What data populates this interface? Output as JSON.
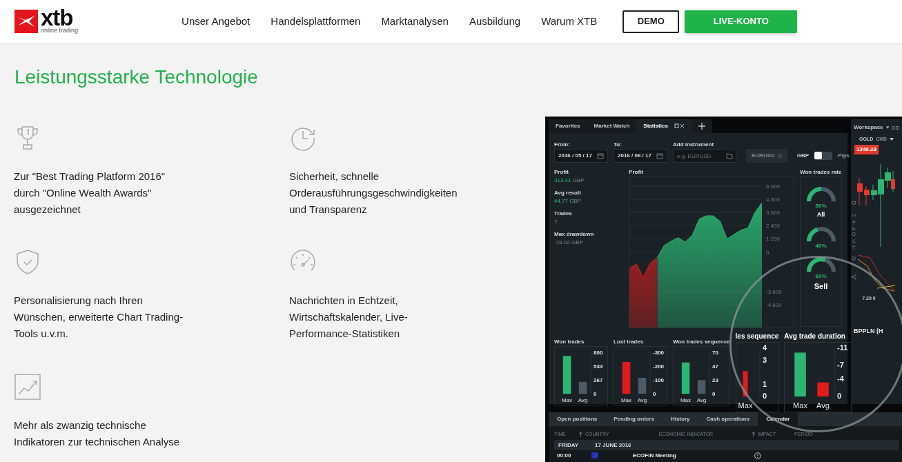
{
  "header": {
    "logo": {
      "wordmark": "xtb",
      "tagline": "online trading"
    },
    "nav": [
      "Unser Angebot",
      "Handelsplattformen",
      "Marktanalysen",
      "Ausbildung",
      "Warum XTB"
    ],
    "buttons": [
      {
        "label": "DEMO",
        "kind": "outline"
      },
      {
        "label": "LIVE-KONTO",
        "kind": "solid"
      }
    ]
  },
  "headline": "Leistungsstarke Technologie",
  "features": [
    {
      "kind": "trophy",
      "text": "Zur \"Best Trading Platform 2016\" durch \"Online Wealth Awards\" ausgezeichnet"
    },
    {
      "kind": "clock",
      "text": "Sicherheit, schnelle Orderausführungsgeschwindigkeiten und Transparenz"
    },
    {
      "kind": "shield",
      "text": "Personalisierung nach Ihren Wünschen, erweiterte Chart Trading-Tools u.v.m."
    },
    {
      "kind": "gauge",
      "text": "Nachrichten in Echtzeit, Wirtschaftskalender, Live-Performance-Statistiken"
    },
    {
      "kind": "chart",
      "text": "Mehr als zwanzig technische Indikatoren zur technischen Analyse"
    }
  ],
  "app": {
    "tabs": [
      {
        "label": "Favorites",
        "selected": false
      },
      {
        "label": "Market Watch",
        "selected": false
      },
      {
        "label": "Statistics",
        "selected": true
      }
    ],
    "filters": {
      "from": {
        "label": "From:",
        "value": "2016 / 05 / 17"
      },
      "to": {
        "label": "To:",
        "value": "2016 / 06 / 17"
      },
      "instrument": {
        "label": "Add instrument",
        "placeholder": "e.g. EURUSD"
      },
      "chip": "EURUSD",
      "unit_toggle": {
        "left": "GBP",
        "right": "Pips",
        "on": false
      }
    },
    "stats": [
      {
        "label": "Profit",
        "value": "313.41",
        "unit": "GBP"
      },
      {
        "label": "Avg result",
        "value": "44.77",
        "unit": "GBP"
      },
      {
        "label": "Trades",
        "value": "7"
      },
      {
        "label": "Max drawdown",
        "value": "-19.02 GBP"
      }
    ],
    "profit_chart": {
      "title": "Profit",
      "chart_data": {
        "type": "line",
        "grid": true,
        "ylim": [
          -6875,
          6816
        ],
        "yticks": [
          {
            "value": 6000,
            "label": "6 000"
          },
          {
            "value": 4800,
            "label": "4 800"
          },
          {
            "value": 3600,
            "label": "3 600"
          },
          {
            "value": 2400,
            "label": "2 400"
          },
          {
            "value": 1200,
            "label": "1 200"
          },
          0,
          {
            "value": -3600,
            "label": "-3 600"
          },
          {
            "value": -4800,
            "label": "-4 800"
          }
        ],
        "series": [
          {
            "color": "#d81e1e",
            "values": [
              -1500,
              -1100,
              -2300,
              -1000,
              -500,
              null,
              null,
              null,
              null,
              null,
              null,
              null,
              null,
              null,
              null,
              null,
              null,
              null,
              null,
              null
            ]
          },
          {
            "color": "#2bb673",
            "values": [
              null,
              null,
              null,
              null,
              -500,
              600,
              1000,
              1300,
              900,
              1500,
              3000,
              3300,
              3300,
              2800,
              1200,
              1600,
              2000,
              2200,
              3600,
              4500
            ]
          }
        ]
      }
    },
    "win_rate": {
      "title": "Won trades rate",
      "gauges": [
        {
          "reading": "50%",
          "label": "All",
          "level": 0.5
        },
        {
          "reading": "40%",
          "level": 0.4
        },
        {
          "reading": "60%",
          "label": "Sell",
          "level": 0.6
        }
      ]
    },
    "bar_charts": [
      {
        "title": "Won trades",
        "magnified": false,
        "chart_data": {
          "type": "bar",
          "categories": [
            "Max",
            "Avg"
          ],
          "ylim": [
            0,
            800
          ],
          "yticks": [
            800,
            533,
            267,
            0
          ],
          "series": [
            {
              "color": "#2bb673",
              "values": [
                730,
                null
              ]
            },
            {
              "color": "#4c5b66",
              "values": [
                null,
                230
              ]
            }
          ]
        }
      },
      {
        "title": "Lost trades",
        "magnified": false,
        "chart_data": {
          "type": "bar",
          "categories": [
            "Max",
            "Avg"
          ],
          "ylim": [
            0,
            -300
          ],
          "yticks": [
            -300,
            -200,
            -100,
            0
          ],
          "series": [
            {
              "color": "#e21b1b",
              "values": [
                -230,
                null
              ]
            },
            {
              "color": "#4c5b66",
              "values": [
                null,
                -115
              ]
            }
          ]
        }
      },
      {
        "title": "Won trades sequence",
        "magnified": false,
        "chart_data": {
          "type": "bar",
          "categories": [
            "Max",
            "Avg"
          ],
          "ylim": [
            0,
            70
          ],
          "yticks": [
            70,
            47,
            23,
            0
          ],
          "series": [
            {
              "color": "#2bb673",
              "values": [
                53,
                null
              ]
            },
            {
              "color": "#4c5b66",
              "values": [
                null,
                23
              ]
            }
          ]
        }
      },
      {
        "title": "les sequence",
        "magnified": true,
        "chart_data": {
          "type": "bar",
          "categories": [
            "Max"
          ],
          "ylim": [
            0,
            4
          ],
          "yticks": [
            4,
            3,
            1,
            0
          ],
          "series": [
            {
              "color": "#e21b1b",
              "values": [
                2.1
              ]
            }
          ]
        }
      },
      {
        "title": "Avg trade duration",
        "magnified": true,
        "chart_data": {
          "type": "bar",
          "categories": [
            "Max",
            "Avg"
          ],
          "ylim": [
            0,
            -11
          ],
          "yticks": [
            -11,
            -7,
            -4,
            0
          ],
          "series": [
            {
              "color": "#2bb673",
              "values": [
                -10,
                null
              ]
            },
            {
              "color": "#e21b1b",
              "values": [
                null,
                -3.2
              ]
            }
          ]
        }
      }
    ],
    "bottom_tabs": [
      {
        "label": "Open positions",
        "selected": false
      },
      {
        "label": "Pending orders",
        "selected": false
      },
      {
        "label": "History",
        "selected": false
      },
      {
        "label": "Cash operations",
        "selected": false
      },
      {
        "label": "Calendar",
        "selected": true
      }
    ],
    "calendar": {
      "columns": [
        {
          "label": "TIME",
          "sortable": false
        },
        {
          "label": "COUNTRY",
          "sortable": true
        },
        {
          "label": "ECONOMIC INDICATOR",
          "sortable": false
        },
        {
          "label": "IMPACT",
          "sortable": true
        },
        {
          "label": "PERIOD",
          "sortable": false
        }
      ],
      "groups": [
        {
          "day": "FRIDAY",
          "date": "17 JUNE 2016",
          "rows": [
            {
              "time": "00:00",
              "indicator": "ECOFIN Meeting"
            }
          ]
        }
      ]
    },
    "workspace": {
      "title": "Workspace",
      "symbol": "GOLD",
      "symbol_type": "CMD",
      "price": "1349.28",
      "axis_label": "7.29 0",
      "instrument": "BPPLN (H"
    }
  }
}
